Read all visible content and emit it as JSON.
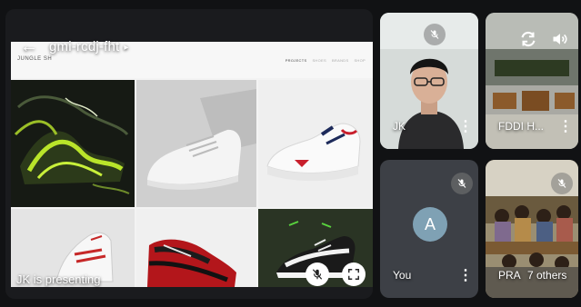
{
  "presentation": {
    "meeting_code": "gmi-rcdj-fht",
    "caret": "▸",
    "back_glyph": "←",
    "presenting_label": "JK is presenting",
    "slide": {
      "brand": "JUNGLE SH",
      "nav": [
        "PROJECTS",
        "SHOES",
        "BRANDS",
        "SHOP"
      ]
    }
  },
  "participants": [
    {
      "id": "jk",
      "name": "JK",
      "muted": true
    },
    {
      "id": "fddi",
      "name": "FDDI H...",
      "muted": false
    },
    {
      "id": "you",
      "name": "You",
      "muted": true,
      "avatar_letter": "A",
      "avatar_color": "#7fa1b4"
    },
    {
      "id": "pra",
      "name": "PRA",
      "muted": true,
      "others_label": "7 others"
    }
  ],
  "more_glyph": "⋮",
  "icons": [
    "back-arrow-icon",
    "switch-camera-icon",
    "speaker-icon",
    "mic-off-icon",
    "fullscreen-icon",
    "more-options-icon"
  ]
}
